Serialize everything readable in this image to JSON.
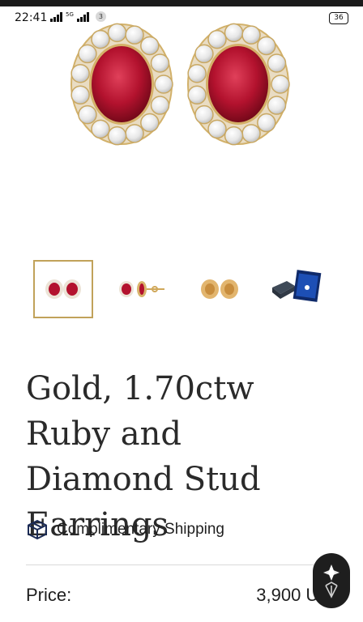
{
  "status_bar": {
    "time": "22:41",
    "network_label": "5G",
    "notification_count": "3",
    "battery": "36"
  },
  "product": {
    "title": "Gold, 1.70ctw Ruby and Diamond Stud Earrings",
    "thumbnail_count": 4,
    "selected_thumbnail": 1
  },
  "shipping": {
    "label": "Complimentary Shipping",
    "icon": "box-icon"
  },
  "price": {
    "label": "Price:",
    "value": "3,900 US"
  },
  "colors": {
    "ruby": "#b3122e",
    "gold": "#c1a25a",
    "chat_button": "#1e1e1e"
  }
}
